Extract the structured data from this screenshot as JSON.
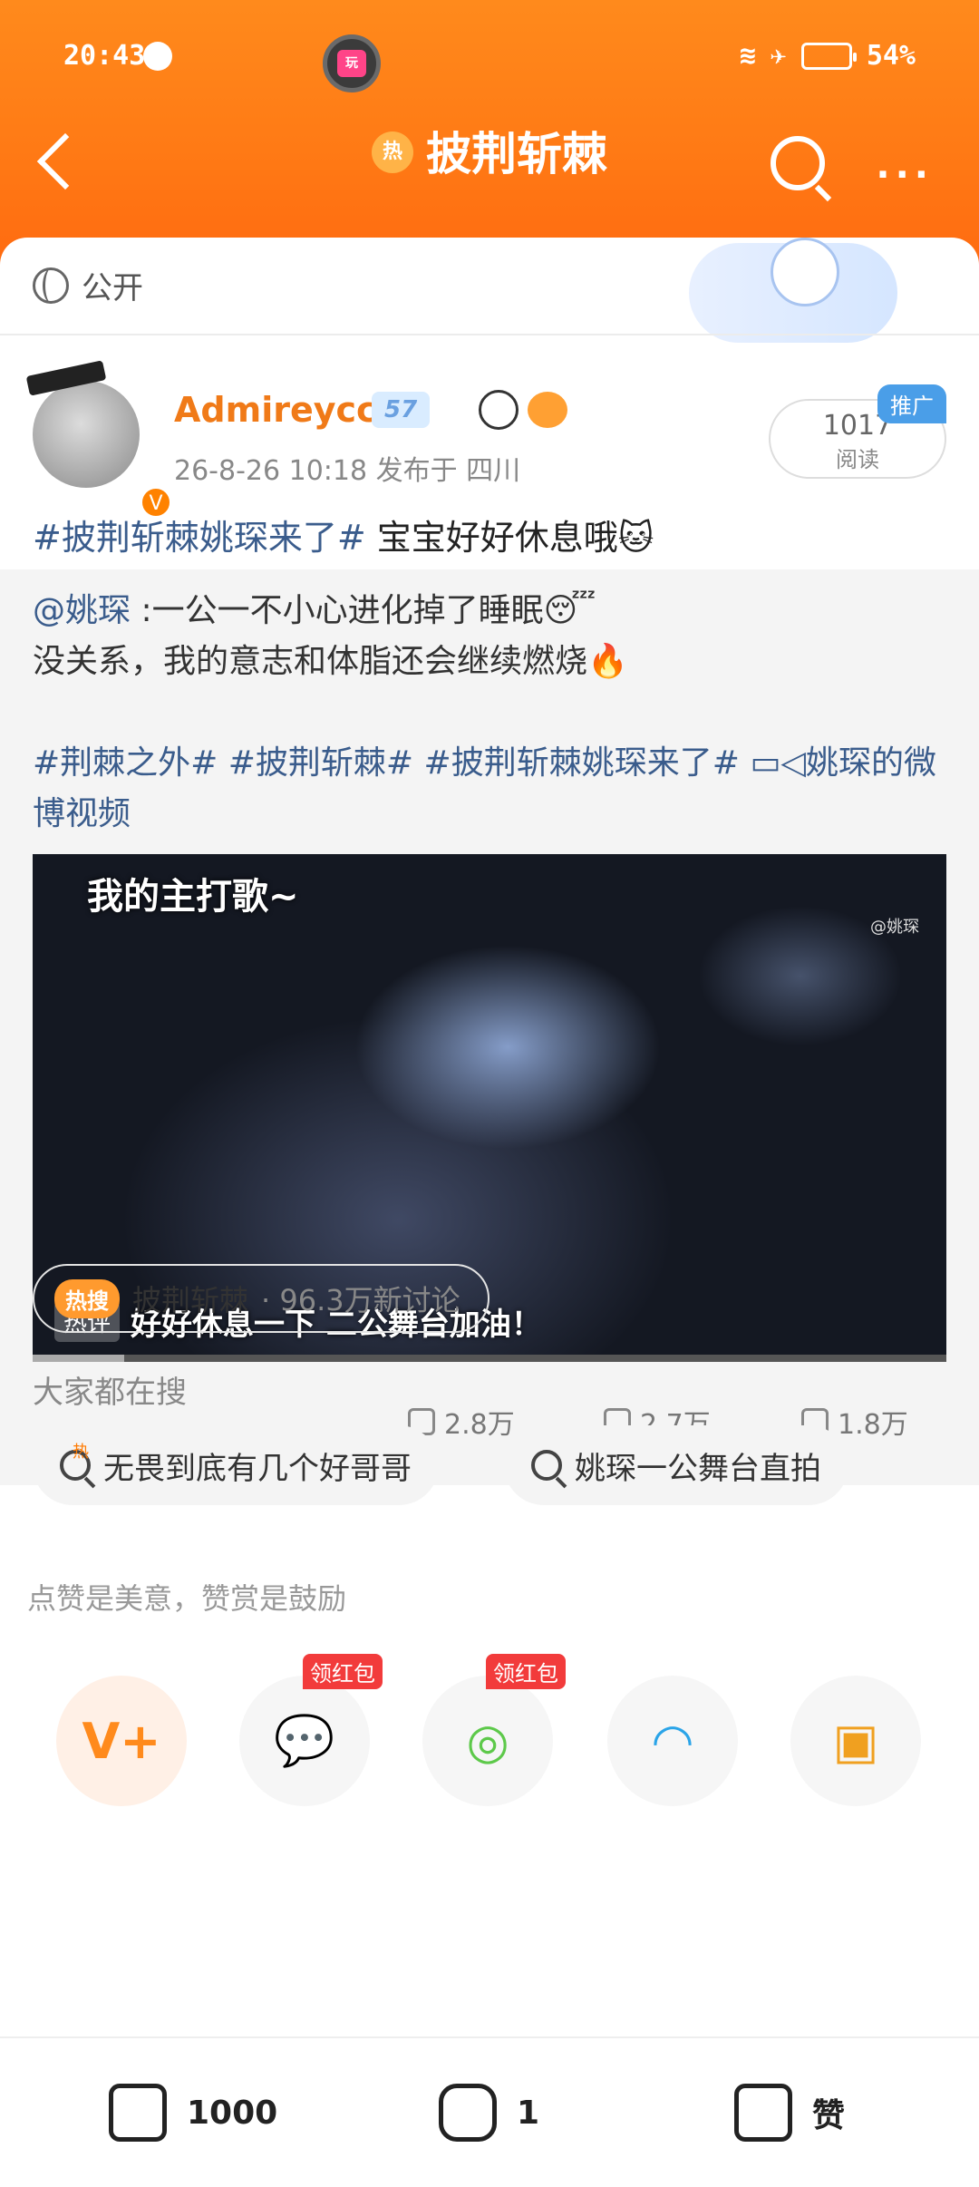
{
  "status": {
    "time": "20:43",
    "battery": "54%"
  },
  "header": {
    "title": "披荆斩棘",
    "hot_badge": "热",
    "back": "back",
    "search": "search",
    "more": "···"
  },
  "visibility": {
    "label": "公开"
  },
  "author": {
    "name": "Admireyccx",
    "level": "57",
    "verified": "V",
    "meta": "26-8-26 10:18  发布于 四川",
    "reads_count": "1017",
    "reads_label": "阅读",
    "promo_label": "推广"
  },
  "post": {
    "headline_tag": "#披荆斩棘姚琛来了#",
    "headline_text": " 宝宝好好休息哦"
  },
  "repost": {
    "mention": "@姚琛",
    "line1": " :一公一不小心进化掉了睡眠😴",
    "line2": "没关系，我的意志和体脂还会继续燃烧🔥",
    "tags": "#荆棘之外# #披荆斩棘# #披荆斩棘姚琛来了# ",
    "video_link": "姚琛的微博视频",
    "video": {
      "caption_top": "我的主打歌~",
      "watermark": "@姚琛",
      "hot_label": "热评",
      "hot_comment": "好好休息一下 二公舞台加油！",
      "progress": 0.1
    },
    "stats": {
      "reposts": "2.8万",
      "comments": "2.7万",
      "likes": "1.8万"
    }
  },
  "topic": {
    "hot_label": "热搜",
    "name": "披荆斩棘",
    "count": "· 96.3万新讨论"
  },
  "search": {
    "title": "大家都在搜",
    "chips": [
      "无畏到底有几个好哥哥",
      "姚琛一公舞台直拍"
    ]
  },
  "tip": "点赞是美意，赞赏是鼓励",
  "share": {
    "items": [
      {
        "name": "vplus",
        "icon": "V+"
      },
      {
        "name": "wechat",
        "icon": "wechat-icon",
        "badge": "领红包"
      },
      {
        "name": "moments",
        "icon": "moments-icon",
        "badge": "领红包"
      },
      {
        "name": "qq",
        "icon": "qq-icon"
      },
      {
        "name": "save-image",
        "icon": "save-image-icon"
      }
    ]
  },
  "bottom": {
    "repost_count": "1000",
    "comment_count": "1",
    "like_label": "赞"
  },
  "colors": {
    "brand": "#ff7a15",
    "link": "#3a5c8c",
    "accent": "#f07a18"
  }
}
